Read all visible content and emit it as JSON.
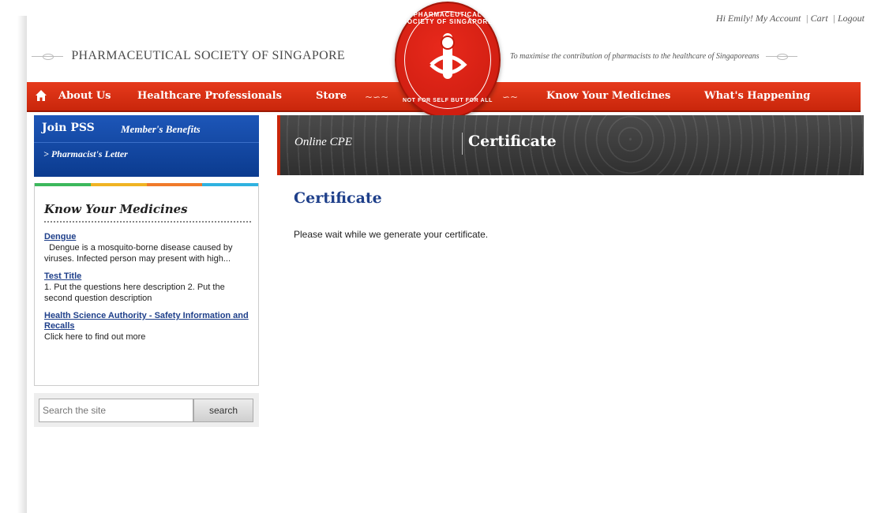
{
  "top_links": {
    "greeting": "Hi Emily!",
    "my_account": "My Account",
    "cart": "Cart",
    "logout": "Logout",
    "separator": "|"
  },
  "header": {
    "site_title": "PHARMACEUTICAL SOCIETY OF SINGAPORE",
    "tagline": "To maximise the contribution of pharmacists to the healthcare of Singaporeans"
  },
  "logo": {
    "text_top": "PHARMACEUTICAL SOCIETY OF SINGAPORE",
    "text_bottom": "NOT FOR SELF BUT FOR ALL"
  },
  "nav": {
    "home_icon": "home-icon",
    "items": [
      "About Us",
      "Healthcare Professionals",
      "Store",
      "Know Your Medicines",
      "What's Happening"
    ],
    "swirl_left": "~∽~",
    "swirl_right": "∽~"
  },
  "sidebar": {
    "join_title": "Join PSS",
    "benefits": "Member's Benefits",
    "letter_link": "> Pharmacist's Letter",
    "strip_colors": [
      "#3cb85c",
      "#f0b323",
      "#f07a2a",
      "#2fb2e0"
    ],
    "kym": {
      "title": "Know Your Medicines",
      "items": [
        {
          "title": "Dengue",
          "desc": "  Dengue is a mosquito-borne disease caused by viruses. Infected person may present with high..."
        },
        {
          "title": "Test Title",
          "desc": "1. Put the questions here description 2. Put the second question description"
        },
        {
          "title": "Health Science Authority - Safety Information and Recalls",
          "desc": "Click here to find out more"
        }
      ]
    },
    "search": {
      "placeholder": "Search the site",
      "button": "search"
    }
  },
  "banner": {
    "crumb": "Online CPE",
    "title": "Certificate"
  },
  "main": {
    "title": "Certificate",
    "message": "Please wait while we generate your certificate."
  },
  "colors": {
    "nav_red": "#d8300f",
    "join_blue": "#1d56b8",
    "link_blue": "#1e3f8a",
    "banner_dark": "#3a3a3a"
  }
}
